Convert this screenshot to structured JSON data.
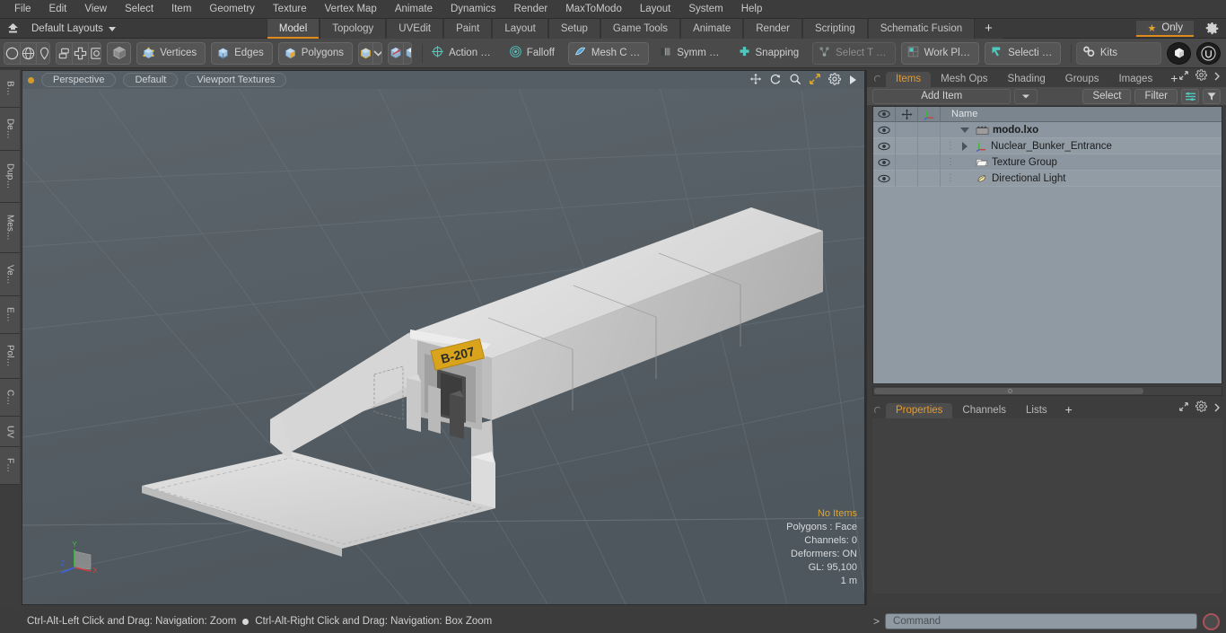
{
  "menubar": {
    "items": [
      "File",
      "Edit",
      "View",
      "Select",
      "Item",
      "Geometry",
      "Texture",
      "Vertex Map",
      "Animate",
      "Dynamics",
      "Render",
      "MaxToModo",
      "Layout",
      "System",
      "Help"
    ]
  },
  "layoutbar": {
    "home_icon": "home-up-icon",
    "layout_name": "Default Layouts",
    "tabs": [
      {
        "label": "Model",
        "active": true
      },
      {
        "label": "Topology",
        "active": false
      },
      {
        "label": "UVEdit",
        "active": false
      },
      {
        "label": "Paint",
        "active": false
      },
      {
        "label": "Layout",
        "active": false
      },
      {
        "label": "Setup",
        "active": false
      },
      {
        "label": "Game Tools",
        "active": false
      },
      {
        "label": "Animate",
        "active": false
      },
      {
        "label": "Render",
        "active": false
      },
      {
        "label": "Scripting",
        "active": false
      },
      {
        "label": "Schematic Fusion",
        "active": false
      }
    ],
    "add_tab_label": "+",
    "only_label": "Only",
    "only_star": "★",
    "gear_icon": "gear-icon",
    "accent_color": "#e08a1e"
  },
  "toolbar": {
    "primitives": [
      "circle-icon",
      "globe-icon",
      "bulb-icon",
      "cone-arrow-icon"
    ],
    "transforms": [
      "stack-icon",
      "plus-frame-icon",
      "square-dot-icon",
      "circle-slash-icon"
    ],
    "center_item": "cube-icon",
    "selection_modes": [
      {
        "label": "Vertices",
        "icon": "cube-vertices-icon"
      },
      {
        "label": "Edges",
        "icon": "cube-edges-icon"
      },
      {
        "label": "Polygons",
        "icon": "cube-polygons-icon"
      }
    ],
    "mode_cube": "cube-mode-icon",
    "mode_dropdown": "chevron-down-icon",
    "axis_buttons": [
      "axis-cube-red-icon",
      "axis-cube-white-icon"
    ],
    "tools": [
      {
        "label": "Action  …",
        "icon": "action-center-icon"
      },
      {
        "label": "Falloff",
        "icon": "falloff-icon"
      },
      {
        "label": "Mesh C …",
        "icon": "mesh-constraint-icon"
      },
      {
        "label": "Symm …",
        "icon": "symmetry-icon"
      },
      {
        "label": "Snapping",
        "icon": "snapping-icon"
      },
      {
        "label": "Select T …",
        "icon": "select-through-icon",
        "dim": true
      },
      {
        "label": "Work Pl…",
        "icon": "work-plane-icon"
      },
      {
        "label": "Selecti …",
        "icon": "selection-icon"
      },
      {
        "label": "Kits",
        "icon": "kits-gears-icon"
      }
    ],
    "right_icons": [
      "modo-cube-icon",
      "unreal-engine-icon"
    ]
  },
  "left_tabs": [
    "B…",
    "De…",
    "Dup…",
    "Mes…",
    "Ve…",
    "E…",
    "Pol…",
    "C…",
    "UV",
    "F…"
  ],
  "viewport": {
    "dot_indicator": "view-active-dot",
    "buttons": [
      "Perspective",
      "Default",
      "Viewport Textures"
    ],
    "header_icons": [
      "pan-icon",
      "rotate-icon",
      "zoom-magnifier-icon",
      "fit-view-icon",
      "gear-icon",
      "play-arrow-icon"
    ],
    "background_color": "#565f65",
    "model_sign_text": "B-207",
    "model_sign_color": "#d9a41c",
    "hud": {
      "items_status": "No Items",
      "polygons": "Polygons : Face",
      "channels": "Channels: 0",
      "deformers": "Deformers: ON",
      "gl": "GL: 95,100",
      "scale": "1 m"
    },
    "gizmo": {
      "x": "X",
      "y": "Y",
      "z": "Z"
    }
  },
  "right_panel": {
    "tabs": [
      {
        "label": "Items",
        "active": true
      },
      {
        "label": "Mesh Ops",
        "active": false
      },
      {
        "label": "Shading",
        "active": false
      },
      {
        "label": "Groups",
        "active": false
      },
      {
        "label": "Images",
        "active": false
      }
    ],
    "add_tab_label": "+",
    "corner_icons": [
      "expand-icon",
      "gear-icon",
      "chevron-right-icon"
    ],
    "add_item_label": "Add Item",
    "add_item_arrow": "chevron-down-icon",
    "select_label": "Select",
    "filter_label": "Filter",
    "list_icons": [
      "list-options-icon",
      "filter-funnel-icon"
    ],
    "list_header": {
      "eye_icon": "eye-icon",
      "move_icon": "move-crosshair-icon",
      "axis_icon": "axis-icon",
      "name_label": "Name"
    },
    "items": [
      {
        "name": "modo.lxo",
        "icon": "clapperboard-icon",
        "bold": true,
        "depth": 0,
        "expander": "open"
      },
      {
        "name": "Nuclear_Bunker_Entrance",
        "icon": "axis-mesh-icon",
        "bold": false,
        "depth": 1,
        "expander": "closed"
      },
      {
        "name": "Texture Group",
        "icon": "folder-icon",
        "bold": false,
        "depth": 1,
        "expander": "none"
      },
      {
        "name": "Directional Light",
        "icon": "light-icon",
        "bold": false,
        "depth": 1,
        "expander": "none"
      }
    ],
    "properties_tabs": [
      {
        "label": "Properties",
        "active": true
      },
      {
        "label": "Channels",
        "active": false
      },
      {
        "label": "Lists",
        "active": false
      }
    ],
    "properties_add_label": "+"
  },
  "statusbar": {
    "hint_left": "Ctrl-Alt-Left Click and Drag: Navigation: Zoom",
    "separator": "●",
    "hint_right": "Ctrl-Alt-Right Click and Drag: Navigation: Box Zoom"
  },
  "commandbar": {
    "prompt": "&gt;",
    "placeholder": "Command",
    "value": "",
    "record_icon": "record-circle-icon"
  }
}
